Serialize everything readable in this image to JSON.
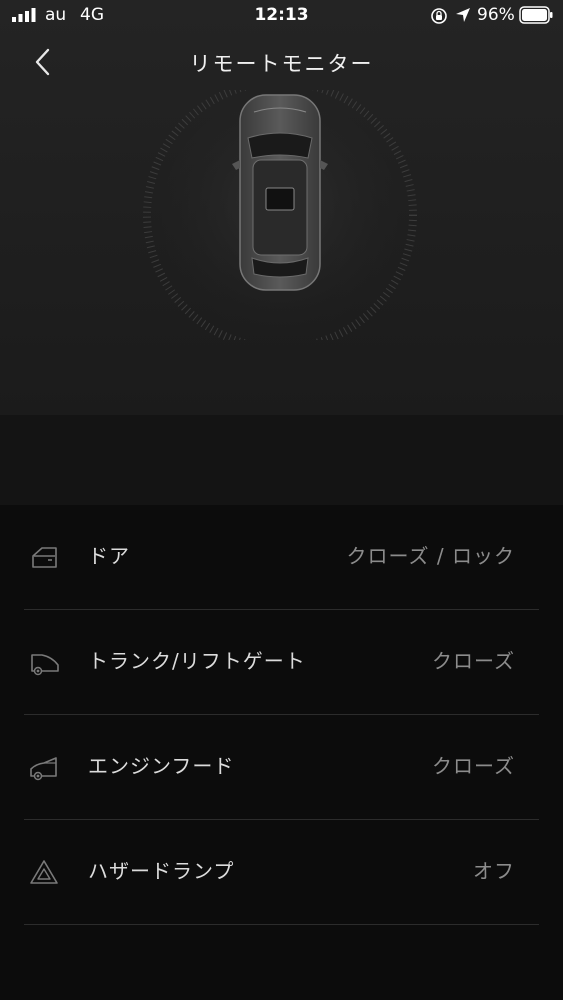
{
  "status_bar": {
    "carrier": "au",
    "network": "4G",
    "time": "12:13",
    "battery": "96%"
  },
  "header": {
    "title": "リモートモニター",
    "back_icon": "chevron-left-icon"
  },
  "vehicle": {
    "view": "top-down-car-image"
  },
  "status_items": [
    {
      "icon": "door-icon",
      "label": "ドア",
      "value": "クローズ / ロック"
    },
    {
      "icon": "trunk-icon",
      "label": "トランク/リフトゲート",
      "value": "クローズ"
    },
    {
      "icon": "hood-icon",
      "label": "エンジンフード",
      "value": "クローズ"
    },
    {
      "icon": "hazard-icon",
      "label": "ハザードランプ",
      "value": "オフ"
    }
  ],
  "colors": {
    "background": "#0c0c0c",
    "hero_background": "#222222",
    "label_text": "#dcdcdc",
    "value_text": "#8c8c8c",
    "divider": "#2c2c2c"
  }
}
